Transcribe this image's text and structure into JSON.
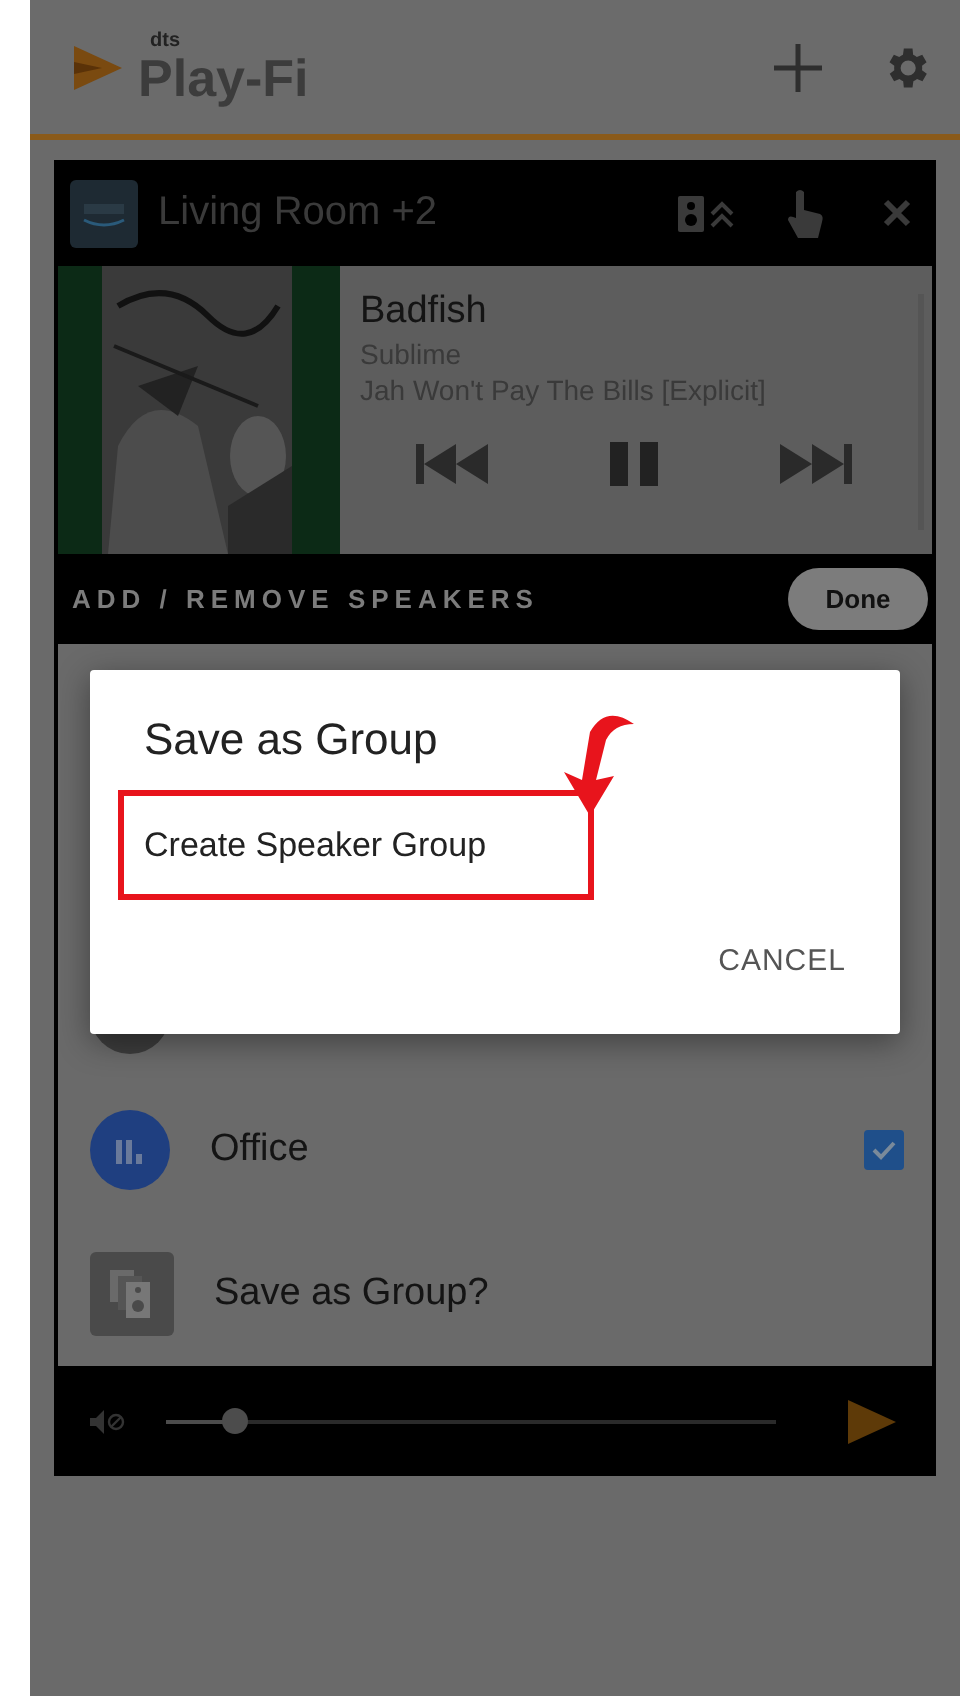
{
  "header": {
    "brand_small": "dts",
    "brand": "Play-Fi"
  },
  "zone": {
    "name": "Living Room +2"
  },
  "now_playing": {
    "title": "Badfish",
    "artist": "Sublime",
    "album": "Jah Won't Pay The Bills [Explicit]"
  },
  "speakers_bar": {
    "label": "ADD / REMOVE SPEAKERS",
    "done": "Done"
  },
  "speakers": [
    {
      "kind": "partial"
    },
    {
      "kind": "speaker",
      "name": "Office",
      "checked": true
    },
    {
      "kind": "action",
      "name": "Save as Group?"
    }
  ],
  "volume": {
    "level": 0.11
  },
  "dialog": {
    "title": "Save as Group",
    "option": "Create Speaker Group",
    "cancel": "CANCEL"
  }
}
